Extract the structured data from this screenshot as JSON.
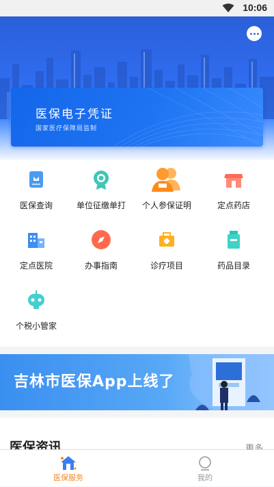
{
  "status_bar": {
    "time": "10:06"
  },
  "hero": {
    "card_title": "医保电子凭证",
    "card_subtitle": "国家医疗保障局监制"
  },
  "services": [
    {
      "label": "医保查询",
      "icon": "medical-card-icon"
    },
    {
      "label": "单位征缴单打",
      "icon": "badge-icon"
    },
    {
      "label": "个人参保证明",
      "icon": "people-icon"
    },
    {
      "label": "定点药店",
      "icon": "store-icon"
    },
    {
      "label": "定点医院",
      "icon": "hospital-icon"
    },
    {
      "label": "办事指南",
      "icon": "compass-icon"
    },
    {
      "label": "诊疗项目",
      "icon": "medkit-icon"
    },
    {
      "label": "药品目录",
      "icon": "medicine-bottle-icon"
    },
    {
      "label": "个税小管家",
      "icon": "robot-icon"
    }
  ],
  "banner": {
    "text": "吉林市医保App上线了"
  },
  "news": {
    "heading": "医保资讯",
    "more": "更多"
  },
  "tabbar": {
    "tabs": [
      {
        "label": "医保服务",
        "active": true
      },
      {
        "label": "我的",
        "active": false
      }
    ],
    "active_color": "#f08a24",
    "inactive_color": "#999999"
  }
}
